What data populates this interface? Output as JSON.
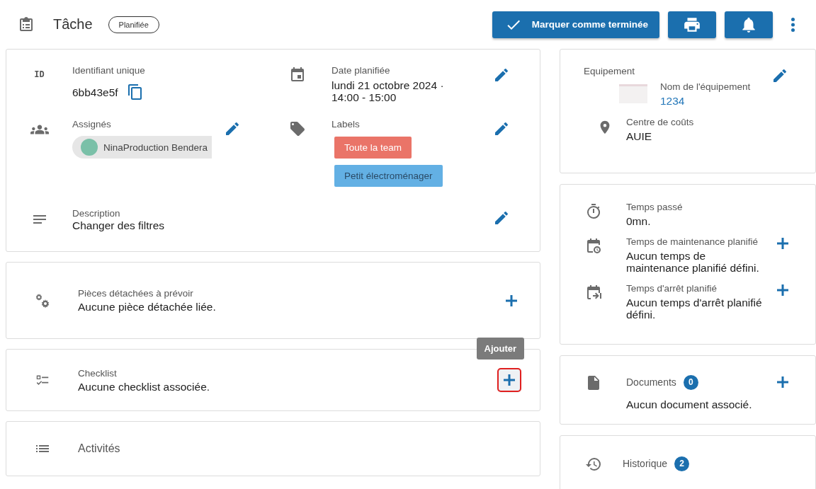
{
  "header": {
    "title": "Tâche",
    "status": "Planifiée",
    "actions": [
      {
        "kind": "complete",
        "label": "Marquer comme terminée"
      },
      {
        "kind": "print"
      },
      {
        "kind": "notify"
      },
      {
        "kind": "more"
      }
    ]
  },
  "details": {
    "id": {
      "icon": "ID",
      "label": "Identifiant unique",
      "value": "6bb43e5f"
    },
    "date": {
      "label": "Date planifiée",
      "value": "lundi 21 octobre 2024 · 14:00 - 15:00"
    },
    "assignees": {
      "label": "Assignés",
      "people": [
        "NinaProduction Bendera"
      ]
    },
    "labels": {
      "label": "Labels",
      "tags": [
        {
          "text": "Toute la team",
          "color": "#ea7468"
        },
        {
          "text": "Petit électroménager",
          "color": "#63b0e4"
        }
      ]
    },
    "description": {
      "label": "Description",
      "value": "Changer des filtres"
    }
  },
  "sections": [
    {
      "kind": "parts",
      "label": "Pièces détachées à prévoir",
      "text": "Aucune pièce détachée liée.",
      "focused": false
    },
    {
      "kind": "checklist",
      "label": "Checklist",
      "text": "Aucune checklist associée.",
      "focused": true,
      "tooltip": "Ajouter"
    },
    {
      "kind": "activities",
      "label": "Activités"
    }
  ],
  "equipment": {
    "label": "Equipement",
    "name_label": "Nom de l'équipement",
    "name": "1234",
    "cost_label": "Centre de coûts",
    "cost": "AUIE"
  },
  "times": [
    {
      "kind": "spent",
      "label": "Temps passé",
      "text": "0mn."
    },
    {
      "kind": "maintenance",
      "label": "Temps de maintenance planifié",
      "text": "Aucun temps de maintenance planifié défini."
    },
    {
      "kind": "downtime",
      "label": "Temps d'arrêt planifié",
      "text": "Aucun temps d'arrêt planifié défini."
    }
  ],
  "documents": {
    "label": "Documents",
    "count": "0",
    "text": "Aucun document associé."
  },
  "history": {
    "label": "Historique",
    "count": "2"
  }
}
